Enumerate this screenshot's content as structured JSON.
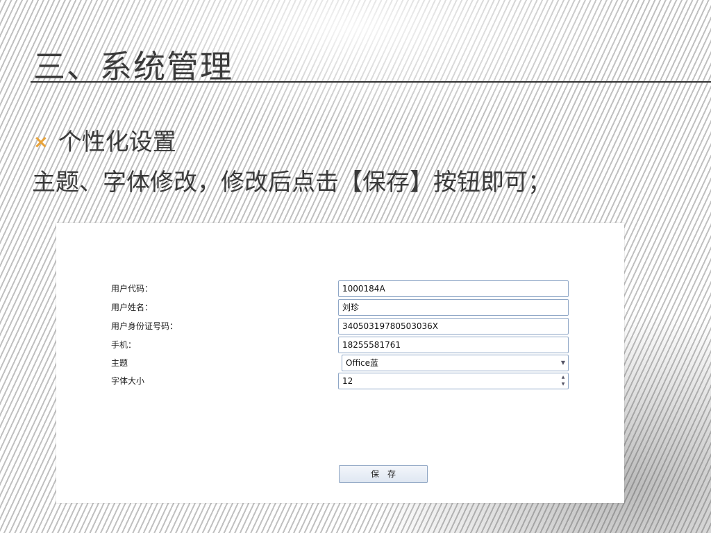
{
  "slide": {
    "title": "三、系统管理",
    "bullet_mark": "×",
    "bullet_text": "个性化设置",
    "instruction": "主题、字体修改，修改后点击【保存】按钮即可；"
  },
  "form": {
    "rows": [
      {
        "label": "用户代码：",
        "value": "1000184A"
      },
      {
        "label": "用户姓名：",
        "value": "刘珍"
      },
      {
        "label": "用户身份证号码：",
        "value": "34050319780503036X"
      },
      {
        "label": "手机：",
        "value": "18255581761"
      }
    ],
    "theme": {
      "label": "主题",
      "value": "Office蓝"
    },
    "font_size": {
      "label": "字体大小",
      "value": "12"
    },
    "save_label": "保存"
  },
  "colors": {
    "bullet": "#e8a33a",
    "field_border": "#8fa7c7"
  },
  "icons": {
    "theme_caret": "chevron-down-icon",
    "spin_buttons": "spin-up-down-icon"
  }
}
